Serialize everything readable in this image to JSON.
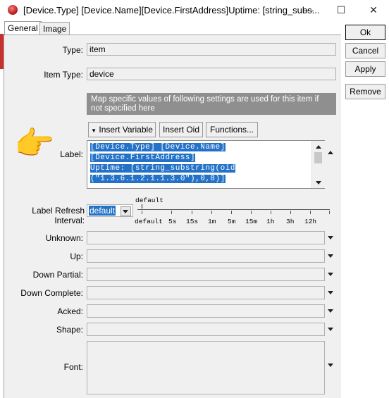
{
  "window": {
    "title": "[Device.Type] [Device.Name][Device.FirstAddress]Uptime: [string_subs...",
    "minimize_glyph": "—",
    "maximize_glyph": "☐",
    "close_glyph": "✕"
  },
  "tabs": [
    {
      "label": "General",
      "active": true
    },
    {
      "label": "Image",
      "active": false
    }
  ],
  "fields": {
    "type": {
      "label": "Type:",
      "value": "item"
    },
    "item_type": {
      "label": "Item Type:",
      "value": "device"
    }
  },
  "note": "Map specific values of following settings are used for this item if not specified here",
  "toolbar": {
    "insert_variable": "Insert Variable",
    "insert_oid": "Insert Oid",
    "functions": "Functions..."
  },
  "label_field": {
    "label": "Label:",
    "lines": [
      "[Device.Type] [Device.Name]",
      "[Device.FirstAddress]",
      "Uptime: [string_substring(oid",
      "(\"1.3.6.1.2.1.1.3.0\"),0,8)]"
    ]
  },
  "refresh": {
    "label": "Label Refresh Interval:",
    "value": "default",
    "scale_top_label": "default",
    "ticks": [
      "default",
      "5s",
      "15s",
      "1m",
      "5m",
      "15m",
      "1h",
      "3h",
      "12h"
    ]
  },
  "map_fields": [
    {
      "label": "Unknown:"
    },
    {
      "label": "Up:"
    },
    {
      "label": "Down Partial:"
    },
    {
      "label": "Down Complete:"
    },
    {
      "label": "Acked:"
    },
    {
      "label": "Shape:"
    },
    {
      "label": "Font:"
    }
  ],
  "side_buttons": {
    "ok": "Ok",
    "cancel": "Cancel",
    "apply": "Apply",
    "remove": "Remove"
  },
  "colors": {
    "selection": "#2472c8",
    "note_bg": "#8f8f8f",
    "panel_bg": "#f0f0f0",
    "app_icon": "#c02020"
  },
  "pointer_emoji": "👉"
}
